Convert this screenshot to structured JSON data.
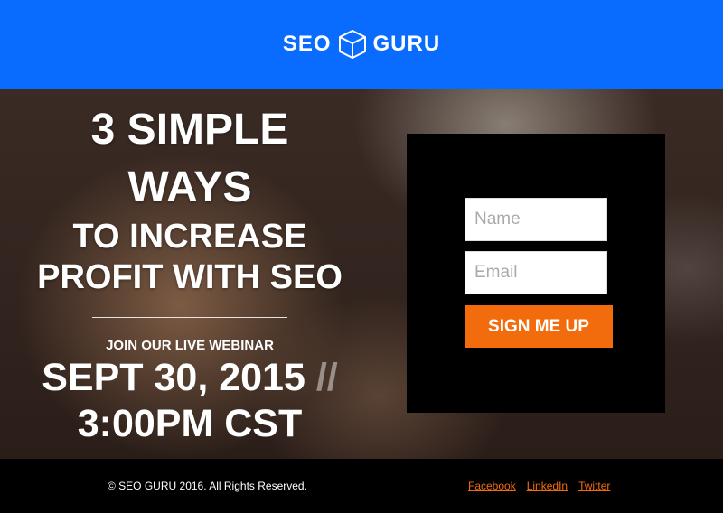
{
  "colors": {
    "header_bg": "#0a6cff",
    "accent": "#f26c0d",
    "footer_bg": "#000000"
  },
  "header": {
    "logo_left": "SEO",
    "logo_icon": "cube-icon",
    "logo_right": "GURU"
  },
  "hero": {
    "headline_line1": "3 SIMPLE",
    "headline_line2": "WAYS",
    "headline_line3": "TO INCREASE",
    "headline_line4": "PROFIT WITH SEO",
    "webinar_label": "JOIN OUR LIVE WEBINAR",
    "date": "SEPT 30, 2015",
    "date_separator": "//",
    "time": "3:00PM CST"
  },
  "form": {
    "name_placeholder": "Name",
    "email_placeholder": "Email",
    "submit_label": "SIGN ME UP"
  },
  "footer": {
    "copyright": "© SEO GURU 2016. All Rights Reserved.",
    "links": [
      "Facebook",
      "LinkedIn",
      "Twitter"
    ]
  }
}
